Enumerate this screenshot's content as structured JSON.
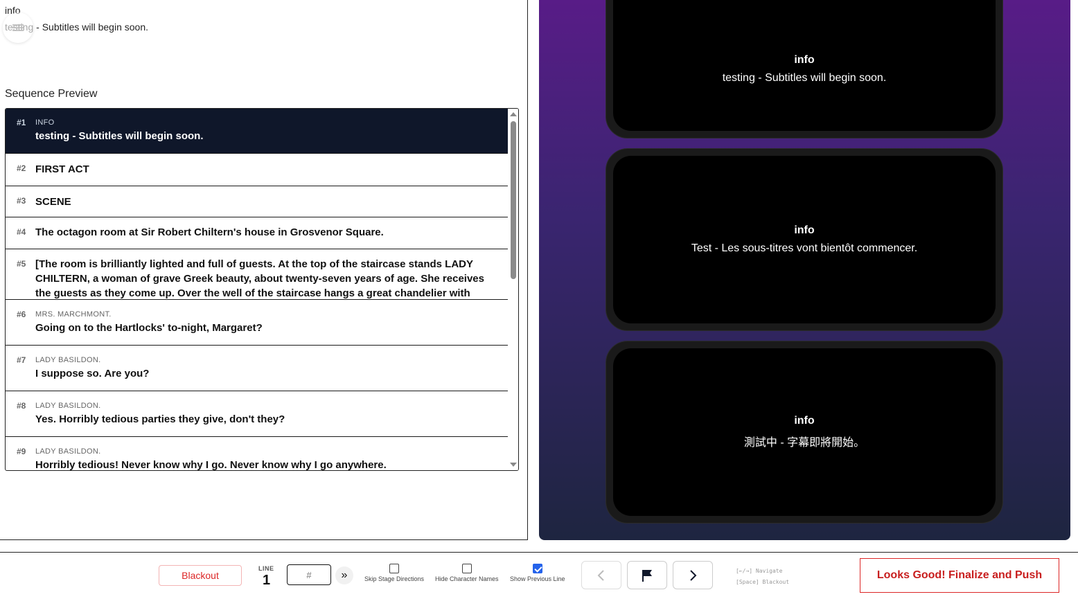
{
  "current": {
    "label": "info",
    "text": "testing - Subtitles will begin soon."
  },
  "sequence": {
    "title": "Sequence Preview",
    "items": [
      {
        "num": "#1",
        "speaker": "INFO",
        "text": "testing - Subtitles will begin soon.",
        "active": true
      },
      {
        "num": "#2",
        "speaker": "",
        "text": "FIRST ACT"
      },
      {
        "num": "#3",
        "speaker": "",
        "text": "SCENE"
      },
      {
        "num": "#4",
        "speaker": "",
        "text": "The octagon room at Sir Robert Chiltern's house in Grosvenor Square."
      },
      {
        "num": "#5",
        "speaker": "",
        "text": "[The room is brilliantly lighted and full of guests. At the top of the staircase stands LADY CHILTERN, a woman of grave Greek beauty, about twenty-seven years of age. She receives the guests as they come up. Over the well of the staircase hangs a great chandelier with"
      },
      {
        "num": "#6",
        "speaker": "MRS. MARCHMONT.",
        "text": "Going on to the Hartlocks' to-night, Margaret?"
      },
      {
        "num": "#7",
        "speaker": "LADY BASILDON.",
        "text": "I suppose so. Are you?"
      },
      {
        "num": "#8",
        "speaker": "LADY BASILDON.",
        "text": "Yes. Horribly tedious parties they give, don't they?"
      },
      {
        "num": "#9",
        "speaker": "LADY BASILDON.",
        "text": "Horribly tedious! Never know why I go. Never know why I go anywhere."
      }
    ]
  },
  "previews": [
    {
      "title": "info",
      "text": "testing - Subtitles will begin soon."
    },
    {
      "title": "info",
      "text": "Test - Les sous-titres vont bientôt commencer."
    },
    {
      "title": "info",
      "text": "測試中 - 字幕即將開始。"
    }
  ],
  "controls": {
    "blackout_label": "Blackout",
    "line_label": "LINE",
    "line_value": "1",
    "jump_placeholder": "#",
    "jump_icon": "»",
    "skip_stage_label": "Skip Stage Directions",
    "skip_stage_checked": false,
    "hide_names_label": "Hide Character Names",
    "hide_names_checked": false,
    "show_prev_label": "Show Previous Line",
    "show_prev_checked": true,
    "hint_navigate": "[←/→] Navigate",
    "hint_blackout": "[Space] Blackout",
    "finalize_label": "Looks Good! Finalize and Push"
  }
}
